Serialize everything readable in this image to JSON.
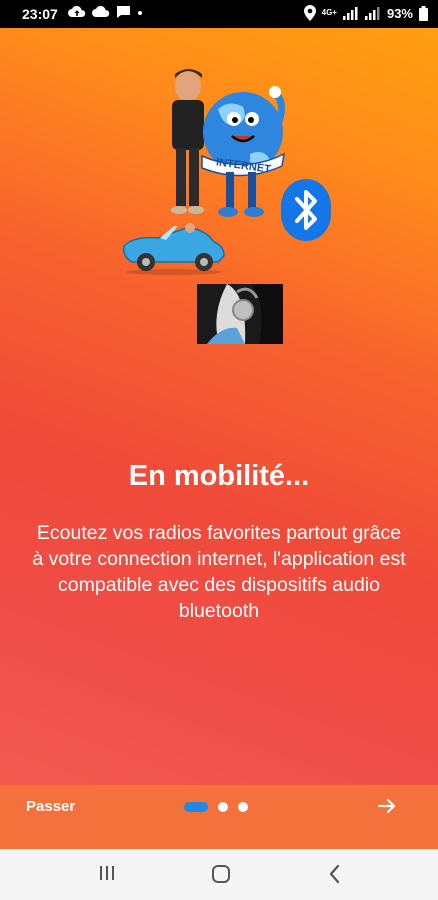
{
  "status_bar": {
    "time": "23:07",
    "battery": "93%",
    "network_label": "4G+",
    "icons": [
      "cloud-upload-icon",
      "cloud-icon",
      "chat-icon",
      "location-icon",
      "signal-icon",
      "battery-icon"
    ]
  },
  "onboarding": {
    "title": "En mobilité...",
    "description": "Ecoutez vos radios favorites partout grâce à votre connection internet, l'application est compatible avec des dispositifs audio bluetooth",
    "globe_label": "INTERNET"
  },
  "bottom": {
    "skip_label": "Passer",
    "page_index": 1,
    "page_count": 3
  },
  "colors": {
    "gradient_top": "#ff9f0f",
    "gradient_bottom": "#f04d48",
    "accent": "#1e88e5",
    "bottom_bar": "#f4713b"
  }
}
